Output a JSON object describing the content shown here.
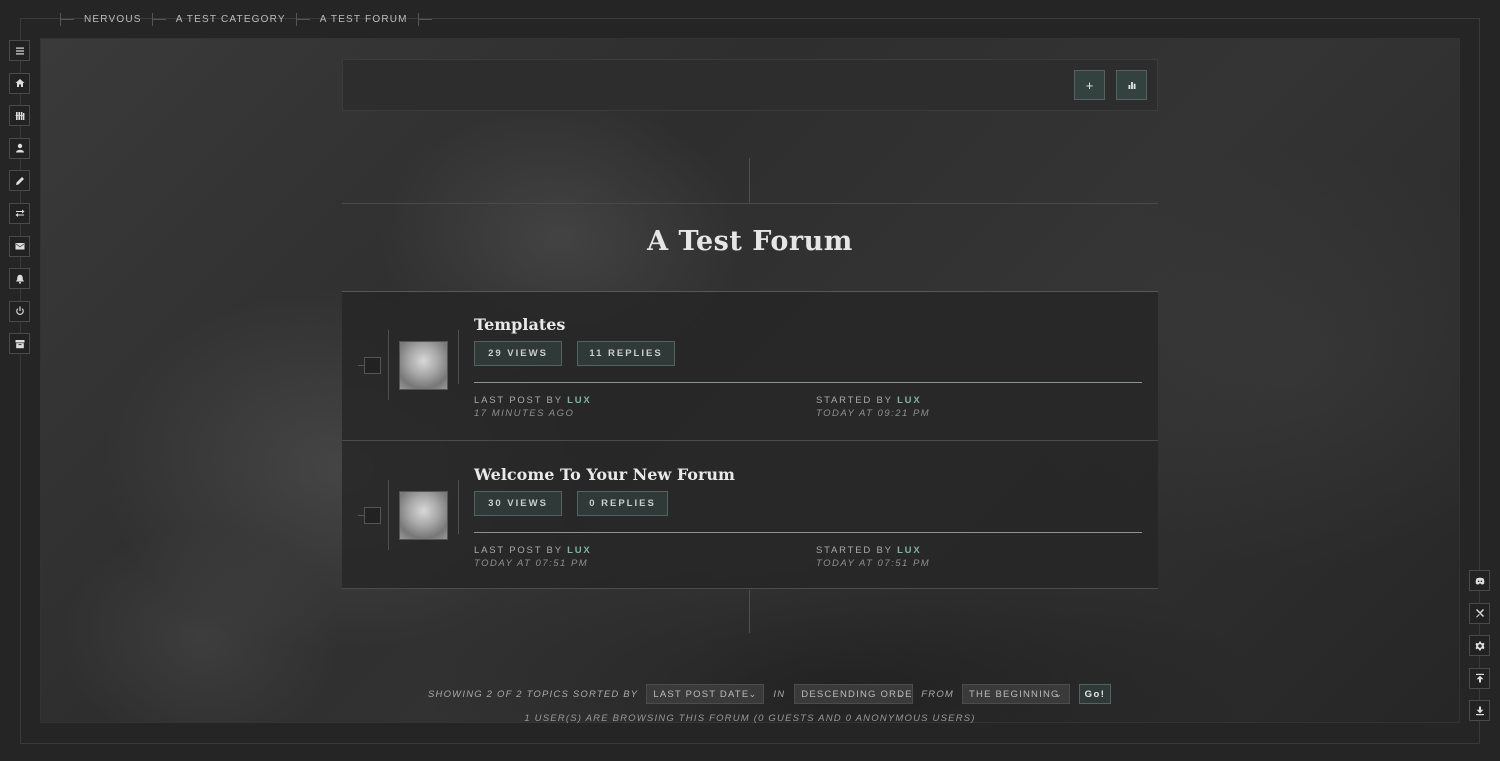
{
  "breadcrumb": [
    "Nervous",
    "A Test Category",
    "A Test Forum"
  ],
  "sidebar": {
    "icons": [
      "menu-icon",
      "home-icon",
      "library-icon",
      "user-icon",
      "pencil-icon",
      "swap-icon",
      "mail-icon",
      "bell-icon",
      "power-icon",
      "archive-icon"
    ]
  },
  "right_sidebar": {
    "icons": [
      "discord-icon",
      "tools-icon",
      "gear-icon",
      "scroll-top-icon",
      "scroll-bottom-icon"
    ]
  },
  "actions": {
    "new_topic_symbol": "+",
    "stats_icon": "bar-chart-icon"
  },
  "forum": {
    "title": "A Test Forum"
  },
  "topics": [
    {
      "title": "Templates",
      "views": "29 Views",
      "replies": "11 Replies",
      "last_post_label": "Last Post By",
      "last_post_user": "Lux",
      "last_post_date": "17 minutes ago",
      "started_label": "Started By",
      "started_user": "Lux",
      "started_date": "Today at 09:21 PM"
    },
    {
      "title": "Welcome To Your New Forum",
      "views": "30 Views",
      "replies": "0 Replies",
      "last_post_label": "Last Post By",
      "last_post_user": "Lux",
      "last_post_date": "Today at 07:51 PM",
      "started_label": "Started By",
      "started_user": "Lux",
      "started_date": "Today at 07:51 PM"
    }
  ],
  "sort": {
    "showing_text": "Showing 2 of 2 topics sorted by",
    "sort_by": "Last Post Date",
    "in_text": "in",
    "order": "Descending Orde",
    "from_text": "from",
    "from": "The Beginning",
    "go": "Go!"
  },
  "browsing_text": "1 user(s) are browsing this forum (0 guests and 0 anonymous users)",
  "colors": {
    "accent": "#7fb3a4",
    "button_bg": "#2f3a38",
    "page_bg": "#252525"
  }
}
